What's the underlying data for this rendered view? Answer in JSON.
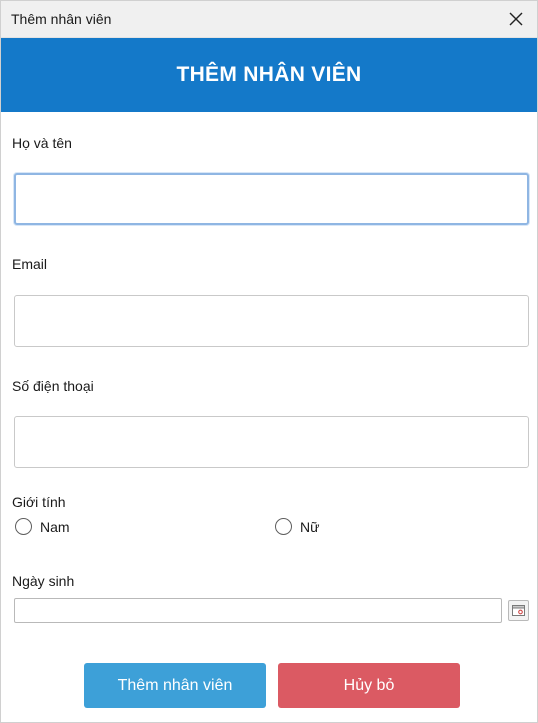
{
  "window": {
    "title": "Thêm nhân viên"
  },
  "header": {
    "title": "THÊM NHÂN VIÊN",
    "color": "#1479c9"
  },
  "form": {
    "name": {
      "label": "Họ và tên",
      "value": "",
      "focused": true
    },
    "email": {
      "label": "Email",
      "value": ""
    },
    "phone": {
      "label": "Số điện thoại",
      "value": ""
    },
    "gender": {
      "label": "Giới tính",
      "options": [
        "Nam",
        "Nữ"
      ],
      "selected": null
    },
    "dob": {
      "label": "Ngày sinh",
      "value": ""
    }
  },
  "actions": {
    "add_label": "Thêm nhân viên",
    "add_color": "#3da0d8",
    "cancel_label": "Hủy bỏ",
    "cancel_color": "#db5a63"
  },
  "icons": {
    "close": "close-icon",
    "calendar": "calendar-icon"
  }
}
